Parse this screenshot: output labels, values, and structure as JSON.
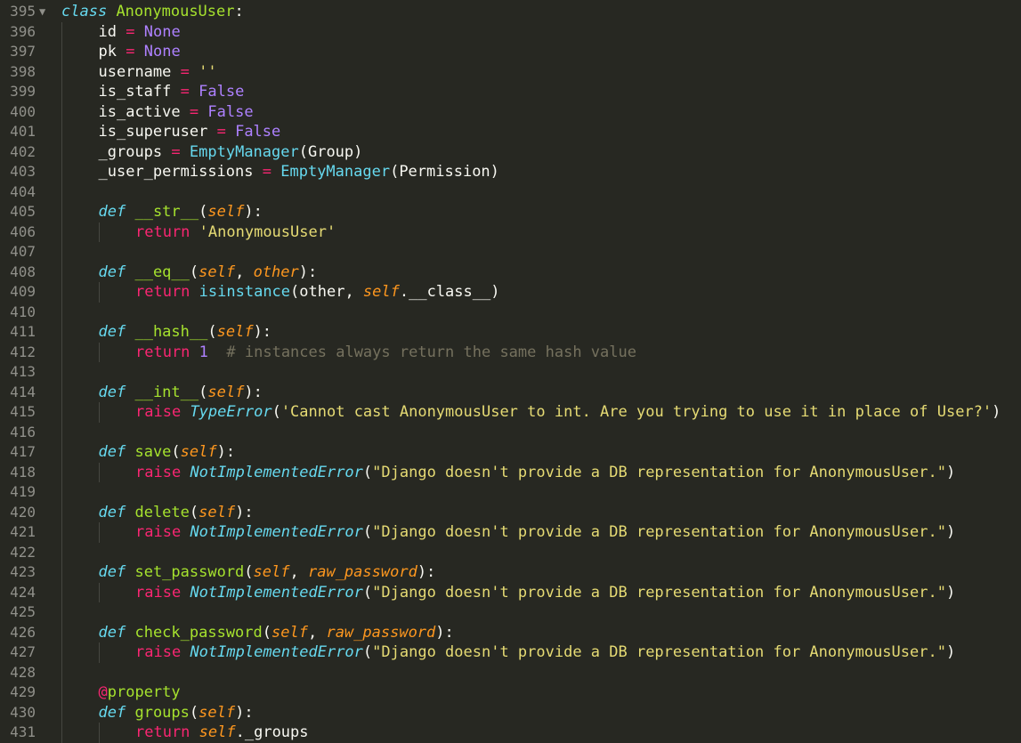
{
  "editor": {
    "theme": "monokai",
    "colors": {
      "background": "#272822",
      "foreground": "#F8F8F2",
      "keyword": "#F92672",
      "storage": "#66D9EF",
      "function": "#A6E22E",
      "constant": "#AE81FF",
      "string": "#E6DB74",
      "parameter": "#FD971F",
      "comment": "#75715E",
      "gutter": "#90908A"
    },
    "fold_icon": "triangle-down-icon",
    "lines": [
      {
        "num": "395",
        "fold": "▼",
        "indent": 0,
        "tokens": [
          {
            "t": "class",
            "c": "kw-it"
          },
          {
            "t": " ",
            "c": "plain"
          },
          {
            "t": "AnonymousUser",
            "c": "cls"
          },
          {
            "t": ":",
            "c": "plain"
          }
        ]
      },
      {
        "num": "396",
        "indent": 1,
        "tokens": [
          {
            "t": "id",
            "c": "plain"
          },
          {
            "t": " ",
            "c": "plain"
          },
          {
            "t": "=",
            "c": "op"
          },
          {
            "t": " ",
            "c": "plain"
          },
          {
            "t": "None",
            "c": "const"
          }
        ]
      },
      {
        "num": "397",
        "indent": 1,
        "tokens": [
          {
            "t": "pk",
            "c": "plain"
          },
          {
            "t": " ",
            "c": "plain"
          },
          {
            "t": "=",
            "c": "op"
          },
          {
            "t": " ",
            "c": "plain"
          },
          {
            "t": "None",
            "c": "const"
          }
        ]
      },
      {
        "num": "398",
        "indent": 1,
        "tokens": [
          {
            "t": "username",
            "c": "plain"
          },
          {
            "t": " ",
            "c": "plain"
          },
          {
            "t": "=",
            "c": "op"
          },
          {
            "t": " ",
            "c": "plain"
          },
          {
            "t": "''",
            "c": "str"
          }
        ]
      },
      {
        "num": "399",
        "indent": 1,
        "tokens": [
          {
            "t": "is_staff",
            "c": "plain"
          },
          {
            "t": " ",
            "c": "plain"
          },
          {
            "t": "=",
            "c": "op"
          },
          {
            "t": " ",
            "c": "plain"
          },
          {
            "t": "False",
            "c": "const"
          }
        ]
      },
      {
        "num": "400",
        "indent": 1,
        "tokens": [
          {
            "t": "is_active",
            "c": "plain"
          },
          {
            "t": " ",
            "c": "plain"
          },
          {
            "t": "=",
            "c": "op"
          },
          {
            "t": " ",
            "c": "plain"
          },
          {
            "t": "False",
            "c": "const"
          }
        ]
      },
      {
        "num": "401",
        "indent": 1,
        "tokens": [
          {
            "t": "is_superuser",
            "c": "plain"
          },
          {
            "t": " ",
            "c": "plain"
          },
          {
            "t": "=",
            "c": "op"
          },
          {
            "t": " ",
            "c": "plain"
          },
          {
            "t": "False",
            "c": "const"
          }
        ]
      },
      {
        "num": "402",
        "indent": 1,
        "tokens": [
          {
            "t": "_groups",
            "c": "plain"
          },
          {
            "t": " ",
            "c": "plain"
          },
          {
            "t": "=",
            "c": "op"
          },
          {
            "t": " ",
            "c": "plain"
          },
          {
            "t": "EmptyManager",
            "c": "builtin"
          },
          {
            "t": "(Group)",
            "c": "plain"
          }
        ]
      },
      {
        "num": "403",
        "indent": 1,
        "tokens": [
          {
            "t": "_user_permissions",
            "c": "plain"
          },
          {
            "t": " ",
            "c": "plain"
          },
          {
            "t": "=",
            "c": "op"
          },
          {
            "t": " ",
            "c": "plain"
          },
          {
            "t": "EmptyManager",
            "c": "builtin"
          },
          {
            "t": "(Permission)",
            "c": "plain"
          }
        ]
      },
      {
        "num": "404",
        "indent": 1,
        "tokens": []
      },
      {
        "num": "405",
        "indent": 1,
        "tokens": [
          {
            "t": "def",
            "c": "kw-it"
          },
          {
            "t": " ",
            "c": "plain"
          },
          {
            "t": "__str__",
            "c": "fn"
          },
          {
            "t": "(",
            "c": "plain"
          },
          {
            "t": "self",
            "c": "param"
          },
          {
            "t": "):",
            "c": "plain"
          }
        ]
      },
      {
        "num": "406",
        "indent": 2,
        "tokens": [
          {
            "t": "return",
            "c": "kw"
          },
          {
            "t": " ",
            "c": "plain"
          },
          {
            "t": "'AnonymousUser'",
            "c": "str"
          }
        ]
      },
      {
        "num": "407",
        "indent": 1,
        "tokens": []
      },
      {
        "num": "408",
        "indent": 1,
        "tokens": [
          {
            "t": "def",
            "c": "kw-it"
          },
          {
            "t": " ",
            "c": "plain"
          },
          {
            "t": "__eq__",
            "c": "fn"
          },
          {
            "t": "(",
            "c": "plain"
          },
          {
            "t": "self",
            "c": "param"
          },
          {
            "t": ", ",
            "c": "plain"
          },
          {
            "t": "other",
            "c": "param"
          },
          {
            "t": "):",
            "c": "plain"
          }
        ]
      },
      {
        "num": "409",
        "indent": 2,
        "tokens": [
          {
            "t": "return",
            "c": "kw"
          },
          {
            "t": " ",
            "c": "plain"
          },
          {
            "t": "isinstance",
            "c": "builtin"
          },
          {
            "t": "(other, ",
            "c": "plain"
          },
          {
            "t": "self",
            "c": "param"
          },
          {
            "t": ".__class__)",
            "c": "plain"
          }
        ]
      },
      {
        "num": "410",
        "indent": 1,
        "tokens": []
      },
      {
        "num": "411",
        "indent": 1,
        "tokens": [
          {
            "t": "def",
            "c": "kw-it"
          },
          {
            "t": " ",
            "c": "plain"
          },
          {
            "t": "__hash__",
            "c": "fn"
          },
          {
            "t": "(",
            "c": "plain"
          },
          {
            "t": "self",
            "c": "param"
          },
          {
            "t": "):",
            "c": "plain"
          }
        ]
      },
      {
        "num": "412",
        "indent": 2,
        "tokens": [
          {
            "t": "return",
            "c": "kw"
          },
          {
            "t": " ",
            "c": "plain"
          },
          {
            "t": "1",
            "c": "const"
          },
          {
            "t": "  ",
            "c": "plain"
          },
          {
            "t": "# instances always return the same hash value",
            "c": "cmt"
          }
        ]
      },
      {
        "num": "413",
        "indent": 1,
        "tokens": []
      },
      {
        "num": "414",
        "indent": 1,
        "tokens": [
          {
            "t": "def",
            "c": "kw-it"
          },
          {
            "t": " ",
            "c": "plain"
          },
          {
            "t": "__int__",
            "c": "fn"
          },
          {
            "t": "(",
            "c": "plain"
          },
          {
            "t": "self",
            "c": "param"
          },
          {
            "t": "):",
            "c": "plain"
          }
        ]
      },
      {
        "num": "415",
        "indent": 2,
        "tokens": [
          {
            "t": "raise",
            "c": "kw"
          },
          {
            "t": " ",
            "c": "plain"
          },
          {
            "t": "TypeError",
            "c": "exc"
          },
          {
            "t": "(",
            "c": "plain"
          },
          {
            "t": "'Cannot cast AnonymousUser to int. Are you trying to use it in place of User?'",
            "c": "str"
          },
          {
            "t": ")",
            "c": "plain"
          }
        ]
      },
      {
        "num": "416",
        "indent": 1,
        "tokens": []
      },
      {
        "num": "417",
        "indent": 1,
        "tokens": [
          {
            "t": "def",
            "c": "kw-it"
          },
          {
            "t": " ",
            "c": "plain"
          },
          {
            "t": "save",
            "c": "fn"
          },
          {
            "t": "(",
            "c": "plain"
          },
          {
            "t": "self",
            "c": "param"
          },
          {
            "t": "):",
            "c": "plain"
          }
        ]
      },
      {
        "num": "418",
        "indent": 2,
        "tokens": [
          {
            "t": "raise",
            "c": "kw"
          },
          {
            "t": " ",
            "c": "plain"
          },
          {
            "t": "NotImplementedError",
            "c": "exc"
          },
          {
            "t": "(",
            "c": "plain"
          },
          {
            "t": "\"Django doesn't provide a DB representation for AnonymousUser.\"",
            "c": "str"
          },
          {
            "t": ")",
            "c": "plain"
          }
        ]
      },
      {
        "num": "419",
        "indent": 1,
        "tokens": []
      },
      {
        "num": "420",
        "indent": 1,
        "tokens": [
          {
            "t": "def",
            "c": "kw-it"
          },
          {
            "t": " ",
            "c": "plain"
          },
          {
            "t": "delete",
            "c": "fn"
          },
          {
            "t": "(",
            "c": "plain"
          },
          {
            "t": "self",
            "c": "param"
          },
          {
            "t": "):",
            "c": "plain"
          }
        ]
      },
      {
        "num": "421",
        "indent": 2,
        "tokens": [
          {
            "t": "raise",
            "c": "kw"
          },
          {
            "t": " ",
            "c": "plain"
          },
          {
            "t": "NotImplementedError",
            "c": "exc"
          },
          {
            "t": "(",
            "c": "plain"
          },
          {
            "t": "\"Django doesn't provide a DB representation for AnonymousUser.\"",
            "c": "str"
          },
          {
            "t": ")",
            "c": "plain"
          }
        ]
      },
      {
        "num": "422",
        "indent": 1,
        "tokens": []
      },
      {
        "num": "423",
        "indent": 1,
        "tokens": [
          {
            "t": "def",
            "c": "kw-it"
          },
          {
            "t": " ",
            "c": "plain"
          },
          {
            "t": "set_password",
            "c": "fn"
          },
          {
            "t": "(",
            "c": "plain"
          },
          {
            "t": "self",
            "c": "param"
          },
          {
            "t": ", ",
            "c": "plain"
          },
          {
            "t": "raw_password",
            "c": "param"
          },
          {
            "t": "):",
            "c": "plain"
          }
        ]
      },
      {
        "num": "424",
        "indent": 2,
        "tokens": [
          {
            "t": "raise",
            "c": "kw"
          },
          {
            "t": " ",
            "c": "plain"
          },
          {
            "t": "NotImplementedError",
            "c": "exc"
          },
          {
            "t": "(",
            "c": "plain"
          },
          {
            "t": "\"Django doesn't provide a DB representation for AnonymousUser.\"",
            "c": "str"
          },
          {
            "t": ")",
            "c": "plain"
          }
        ]
      },
      {
        "num": "425",
        "indent": 1,
        "tokens": []
      },
      {
        "num": "426",
        "indent": 1,
        "tokens": [
          {
            "t": "def",
            "c": "kw-it"
          },
          {
            "t": " ",
            "c": "plain"
          },
          {
            "t": "check_password",
            "c": "fn"
          },
          {
            "t": "(",
            "c": "plain"
          },
          {
            "t": "self",
            "c": "param"
          },
          {
            "t": ", ",
            "c": "plain"
          },
          {
            "t": "raw_password",
            "c": "param"
          },
          {
            "t": "):",
            "c": "plain"
          }
        ]
      },
      {
        "num": "427",
        "indent": 2,
        "tokens": [
          {
            "t": "raise",
            "c": "kw"
          },
          {
            "t": " ",
            "c": "plain"
          },
          {
            "t": "NotImplementedError",
            "c": "exc"
          },
          {
            "t": "(",
            "c": "plain"
          },
          {
            "t": "\"Django doesn't provide a DB representation for AnonymousUser.\"",
            "c": "str"
          },
          {
            "t": ")",
            "c": "plain"
          }
        ]
      },
      {
        "num": "428",
        "indent": 1,
        "tokens": []
      },
      {
        "num": "429",
        "indent": 1,
        "tokens": [
          {
            "t": "@",
            "c": "op"
          },
          {
            "t": "property",
            "c": "dec"
          }
        ]
      },
      {
        "num": "430",
        "indent": 1,
        "tokens": [
          {
            "t": "def",
            "c": "kw-it"
          },
          {
            "t": " ",
            "c": "plain"
          },
          {
            "t": "groups",
            "c": "fn"
          },
          {
            "t": "(",
            "c": "plain"
          },
          {
            "t": "self",
            "c": "param"
          },
          {
            "t": "):",
            "c": "plain"
          }
        ]
      },
      {
        "num": "431",
        "indent": 2,
        "tokens": [
          {
            "t": "return",
            "c": "kw"
          },
          {
            "t": " ",
            "c": "plain"
          },
          {
            "t": "self",
            "c": "param"
          },
          {
            "t": "._groups",
            "c": "plain"
          }
        ]
      }
    ]
  }
}
